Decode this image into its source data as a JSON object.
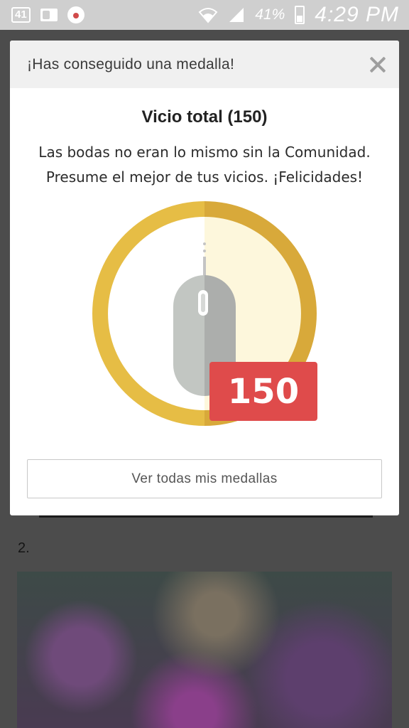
{
  "status_bar": {
    "notification_badge": "41",
    "battery": "41%",
    "time": "4:29 PM",
    "icons": [
      "notification-badge-icon",
      "outlook-icon",
      "app-notification-icon",
      "wifi-icon",
      "signal-icon",
      "battery-icon"
    ]
  },
  "modal": {
    "header_title": "¡Has conseguido una medalla!",
    "medal_title": "Vicio total (150)",
    "description_line1": "Las bodas no eran lo mismo sin la Comunidad.",
    "description_line2": "Presume el mejor de tus vicios. ¡Felicidades!",
    "badge_count": "150",
    "medal_icon": "computer-mouse-icon",
    "all_medals_button": "Ver todas mis medallas",
    "colors": {
      "ring": "#e3b83a",
      "badge": "#df4b4b",
      "mouse": "#bcbcbc"
    }
  },
  "background": {
    "list_number": "2."
  }
}
